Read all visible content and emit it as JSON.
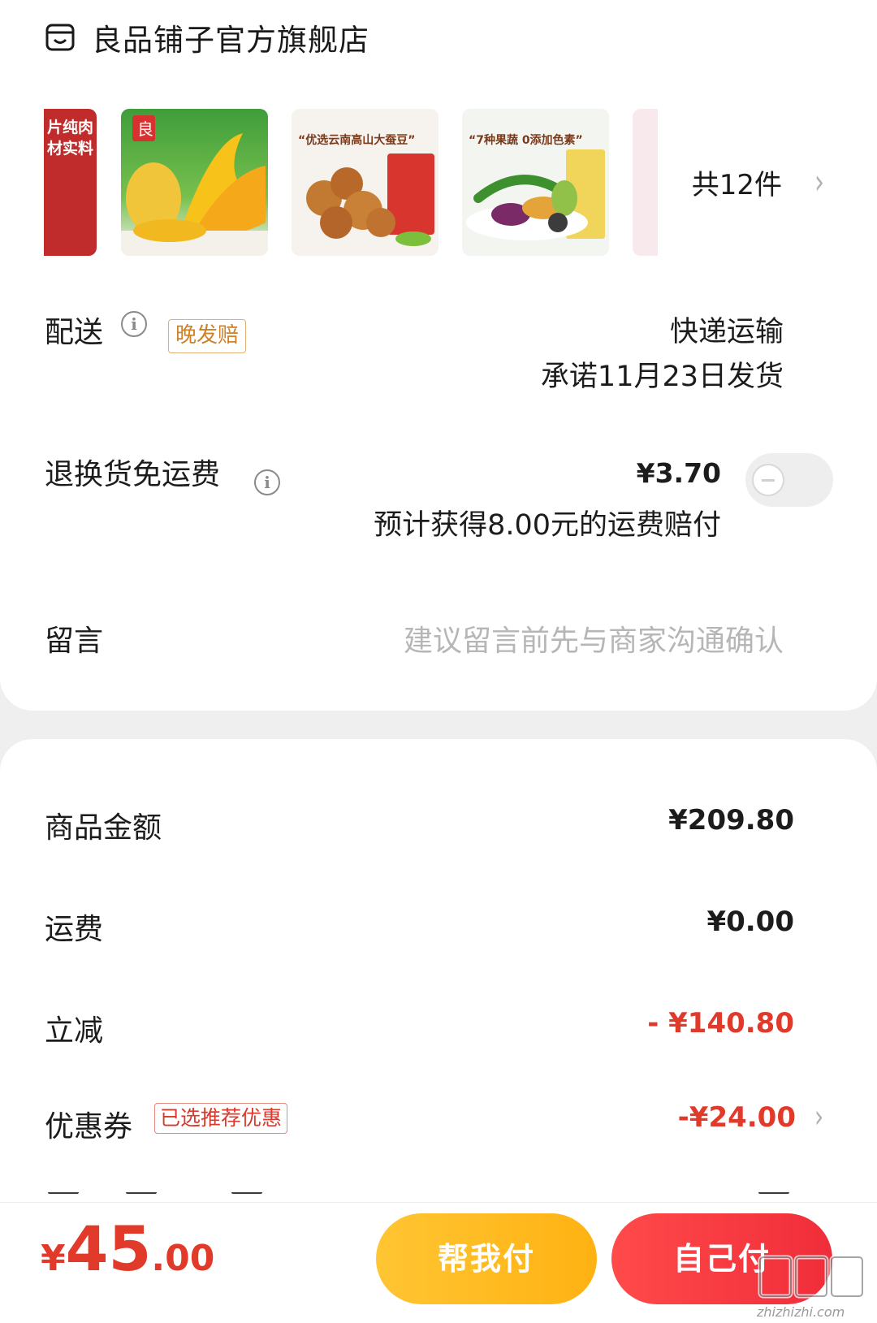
{
  "shop": {
    "name": "良品铺子官方旗舰店",
    "icon": "shop-icon"
  },
  "products": {
    "thumbs": [
      {
        "caption": "片纯肉 材实料"
      },
      {
        "caption": ""
      },
      {
        "caption": "“优选云南高山大蚕豆”"
      },
      {
        "caption": "“7种果蔬 0添加色素”"
      },
      {
        "caption": ""
      }
    ],
    "count_label": "共12件",
    "chevron": "›"
  },
  "delivery": {
    "label": "配送",
    "info_icon": "ⓘ",
    "badge": "晚发赔",
    "method": "快递运输",
    "promise": "承诺11月23日发货"
  },
  "return_shipping": {
    "label": "退换货免运费",
    "price": "¥3.70",
    "note": "预计获得8.00元的运费赔付",
    "toggle_on": false
  },
  "message": {
    "label": "留言",
    "placeholder": "建议留言前先与商家沟通确认"
  },
  "summary": {
    "goods_label": "商品金额",
    "goods_value": "¥209.80",
    "shipping_label": "运费",
    "shipping_value": "¥0.00",
    "discount_label": "立减",
    "discount_value": "- ¥140.80",
    "coupon_label": "优惠券",
    "coupon_badge": "已选推荐优惠",
    "coupon_value": "-¥24.00"
  },
  "bottom": {
    "total_symbol": "¥",
    "total_int": "45",
    "total_dec": ".00",
    "help_pay": "帮我付",
    "self_pay": "自己付"
  },
  "watermark": {
    "text": "值值值",
    "sub": "zhizhizhi.com"
  },
  "colors": {
    "accent_red": "#e23a2a",
    "accent_orange": "#ffb212",
    "badge_orange": "#cf8128"
  }
}
